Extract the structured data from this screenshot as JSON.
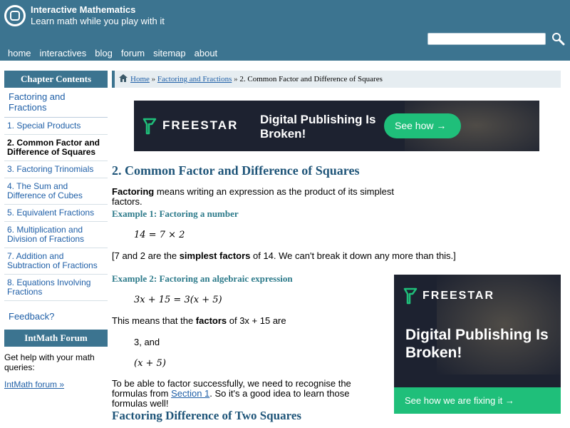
{
  "header": {
    "title": "Interactive Mathematics",
    "tagline": "Learn math while you play with it",
    "search_placeholder": "",
    "nav": [
      "home",
      "interactives",
      "blog",
      "forum",
      "sitemap",
      "about"
    ]
  },
  "sidebar": {
    "heading": "Chapter Contents",
    "chapter": "Factoring and Fractions",
    "items": [
      {
        "label": "1. Special Products"
      },
      {
        "label": "2. Common Factor and Difference of Squares"
      },
      {
        "label": "3. Factoring Trinomials"
      },
      {
        "label": "4. The Sum and Difference of Cubes"
      },
      {
        "label": "5. Equivalent Fractions"
      },
      {
        "label": "6. Multiplication and Division of Fractions"
      },
      {
        "label": "7. Addition and Subtraction of Fractions"
      },
      {
        "label": "8. Equations Involving Fractions"
      }
    ],
    "feedback": "Feedback?",
    "forum_heading": "IntMath Forum",
    "forum_text": "Get help with your math queries:",
    "forum_link": "IntMath forum »"
  },
  "breadcrumb": {
    "home": "Home",
    "sep1": " » ",
    "section": "Factoring and Fractions",
    "sep2": " » ",
    "current": "2. Common Factor and Difference of Squares"
  },
  "ads": {
    "brand": "FREESTAR",
    "top_headline": "Digital Publishing Is Broken!",
    "top_button": "See how →",
    "side_headline": "Digital Publishing Is Broken!",
    "side_button": "See how we are fixing it  →"
  },
  "main": {
    "title": "2. Common Factor and Difference of Squares",
    "intro_bold": "Factoring",
    "intro_rest": " means writing an expression as the product of its simplest factors.",
    "ex1_heading": "Example 1: Factoring a number",
    "ex1_math": "14 = 7 × 2",
    "ex1_note_a": "[7 and 2 are the ",
    "ex1_note_bold": "simplest factors",
    "ex1_note_b": " of 14. We can't break it down any more than this.]",
    "ex2_heading": "Example 2: Factoring an algebraic expression",
    "ex2_math": "3x + 15 = 3(x + 5)",
    "ex2_note_a": "This means that the ",
    "ex2_note_bold": "factors",
    "ex2_note_b": " of 3x + 15 are",
    "factor1": "3, and",
    "factor2": "(x + 5)",
    "formula_text_a": "To be able to factor successfully, we need to recognise the formulas from ",
    "formula_link": "Section 1",
    "formula_text_b": ". So it's a good idea to learn those formulas well!",
    "section_heading": "Factoring Difference of Two Squares"
  },
  "colors": {
    "header_bg": "#3c7490",
    "link": "#1f5fa7",
    "heading": "#1f5579",
    "ad_bg": "#1d2230",
    "ad_button": "#1fbf7a"
  }
}
